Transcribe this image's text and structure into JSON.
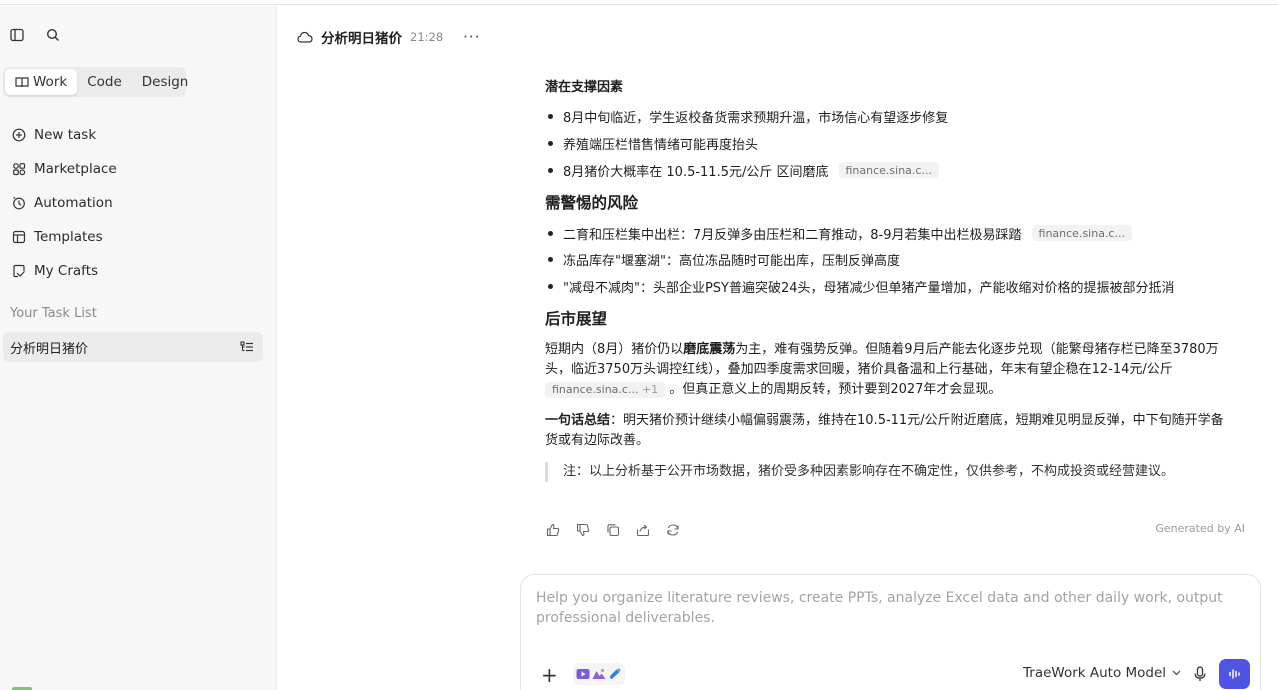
{
  "sidebar": {
    "tabs": [
      {
        "label": "Work",
        "active": true
      },
      {
        "label": "Code",
        "active": false
      },
      {
        "label": "Design",
        "active": false
      }
    ],
    "nav": [
      {
        "label": "New task",
        "icon": "plus-circle-icon"
      },
      {
        "label": "Marketplace",
        "icon": "marketplace-icon"
      },
      {
        "label": "Automation",
        "icon": "clock-icon"
      },
      {
        "label": "Templates",
        "icon": "templates-icon"
      },
      {
        "label": "My Crafts",
        "icon": "crafts-icon"
      }
    ],
    "section_label": "Your Task List",
    "task": "分析明日猪价"
  },
  "header": {
    "title": "分析明日猪价",
    "time": "21:28",
    "more": "···"
  },
  "content": {
    "support_heading": "潜在支撑因素",
    "support_items": [
      "8月中旬临近，学生返校备货需求预期升温，市场信心有望逐步修复",
      "养殖端压栏惜售情绪可能再度抬头",
      "8月猪价大概率在 10.5-11.5元/公斤 区间磨底"
    ],
    "support_cite": "finance.sina.c...",
    "risk_heading": "需警惕的风险",
    "risk_items": [
      "二育和压栏集中出栏：7月反弹多由压栏和二育推动，8-9月若集中出栏极易踩踏",
      "冻品库存\"堰塞湖\"：高位冻品随时可能出库，压制反弹高度",
      "\"减母不减肉\"：头部企业PSY普遍突破24头，母猪减少但单猪产量增加，产能收缩对价格的提振被部分抵消"
    ],
    "risk_cite": "finance.sina.c...",
    "outlook_heading": "后市展望",
    "outlook_p1": "短期内（8月）猪价仍以",
    "outlook_bold": "磨底震荡",
    "outlook_p2": "为主，难有强势反弹。但随着9月后产能去化逐步兑现（能繁母猪存栏已降至3780万头，临近3750万头调控红线），叠加四季度需求回暖，猪价具备温和上行基础，年末有望企稳在12-14元/公斤",
    "outlook_cite": "finance.sina.c...",
    "outlook_cite_more": "+1",
    "outlook_p3": "。但真正意义上的周期反转，预计要到2027年才会显现。",
    "summary_bold": "一句话总结",
    "summary_text": "：明天猪价预计继续小幅偏弱震荡，维持在10.5-11元/公斤附近磨底，短期难见明显反弹，中下旬随开学备货或有边际改善。",
    "note": "注：以上分析基于公开市场数据，猪价受多种因素影响存在不确定性，仅供参考，不构成投资或经营建议。",
    "generated": "Generated by AI"
  },
  "composer": {
    "placeholder": "Help you organize literature reviews, create PPTs, analyze Excel data and other daily work, output professional deliverables.",
    "plus": "+",
    "model": "TraeWork Auto Model"
  },
  "colors": {
    "accent": "#4f54e3",
    "sidebar_bg": "#f7f7f7"
  }
}
